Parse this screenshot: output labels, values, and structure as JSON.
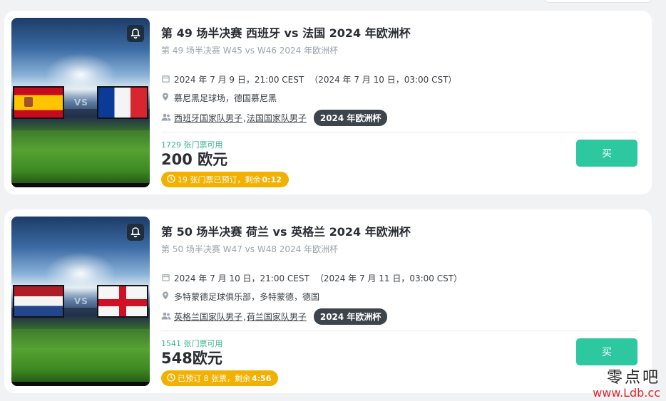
{
  "events": [
    {
      "title": "第 49 场半决赛 西班牙 vs 法国 2024 年欧洲杯",
      "subtitle": "第 49 场半决赛 W45 vs W46 2024 年欧洲杯",
      "date": "2024 年 7 月 9 日，21:00 CEST",
      "date_local": "（2024 年 7 月 10 日，03:00 CST）",
      "venue": "慕尼黑足球场，德国慕尼黑",
      "team1": "西班牙国家队男子",
      "team2": "法国国家队男子",
      "tag": "2024 年欧洲杯",
      "availability": "1729 张门票可用",
      "price": "200 欧元",
      "booked_text": "19 张门票已预订，剩余",
      "booked_time": "0:12",
      "buy_label": "买",
      "vs_text": "VS"
    },
    {
      "title": "第 50 场半决赛 荷兰 vs 英格兰 2024 年欧洲杯",
      "subtitle": "第 50 场半决赛 W47 vs W48 2024 年欧洲杯",
      "date": "2024 年 7 月 10 日，21:00 CEST",
      "date_local": "（2024 年 7 月 11 日，03:00 CST）",
      "venue": "多特蒙德足球俱乐部，多特蒙德，德国",
      "team1": "英格兰国家队男子",
      "team2": "荷兰国家队男子",
      "tag": "2024 年欧洲杯",
      "availability": "1541 张门票可用",
      "price": "548欧元",
      "booked_text": "已预订 8 张票，剩余",
      "booked_time": "4:56",
      "buy_label": "买",
      "vs_text": "VS"
    }
  ],
  "watermark": {
    "top": "零点吧",
    "bottom": "www.Ldb.cc"
  },
  "icons": {
    "bell": "bell-icon",
    "calendar": "calendar-icon",
    "pin": "location-pin-icon",
    "people": "people-icon",
    "clock": "clock-icon"
  },
  "colors": {
    "buy": "#2ec8a0",
    "booked": "#f2b100",
    "availability": "#3ab38a",
    "tag": "#3d444c"
  }
}
